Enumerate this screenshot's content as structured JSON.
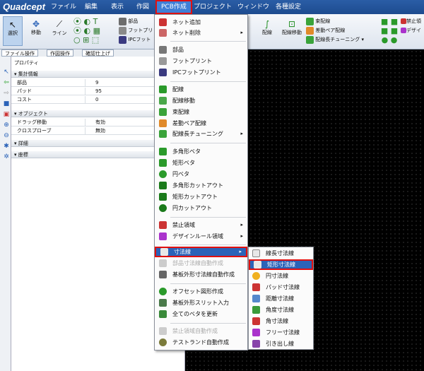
{
  "app": {
    "logo": "Quadcept"
  },
  "menubar": [
    "ファイル",
    "編集",
    "表示",
    "作図",
    "PCB作成",
    "プロジェクト",
    "ウィンドウ",
    "各種設定"
  ],
  "ribbon": {
    "select": "選択",
    "move": "移動",
    "line": "ライン",
    "part": "部品",
    "footprint": "フットプリ",
    "ipc": "IPCフット",
    "wiring": "配線",
    "wiring_move": "配線移動",
    "bundle": "束配線",
    "diff_pair": "差動ペア配線",
    "length_tune": "配線長チューニング",
    "keepout": "禁止領",
    "design": "デザイ"
  },
  "panel_tabs": [
    "ファイル操作",
    "作図操作",
    "確認仕上げ"
  ],
  "properties": {
    "title": "プロパティ",
    "summary_header": "集計情報",
    "rows": [
      {
        "k": "部品",
        "v": "9"
      },
      {
        "k": "パッド",
        "v": "95"
      },
      {
        "k": "コスト",
        "v": "0"
      }
    ],
    "object_header": "オブジェクト",
    "obj_rows": [
      {
        "k": "ドラッグ移動",
        "v": "有効"
      },
      {
        "k": "クロスプローブ",
        "v": "無効"
      }
    ],
    "detail_header": "詳細",
    "coord_header": "座標"
  },
  "menu": {
    "items": [
      "ネット追加",
      "ネット削除",
      "部品",
      "フットプリント",
      "IPCフットプリント",
      "配線",
      "配線移動",
      "束配線",
      "差動ペア配線",
      "配線長チューニング",
      "多角形ベタ",
      "矩形ベタ",
      "円ベタ",
      "多角形カットアウト",
      "矩形カットアウト",
      "円カットアウト",
      "禁止領域",
      "デザインルール領域",
      "寸法線",
      "部品寸法線自動作成",
      "基板外形寸法線自動作成",
      "オフセット図形作成",
      "基板外形スリット入力",
      "全てのベタを更新",
      "禁止領域自動作成",
      "テストランド自動作成"
    ]
  },
  "submenu": {
    "items": [
      "線長寸法線",
      "矩形寸法線",
      "円寸法線",
      "パッド寸法線",
      "距離寸法線",
      "角度寸法線",
      "角寸法線",
      "フリー寸法線",
      "引き出し線"
    ]
  }
}
